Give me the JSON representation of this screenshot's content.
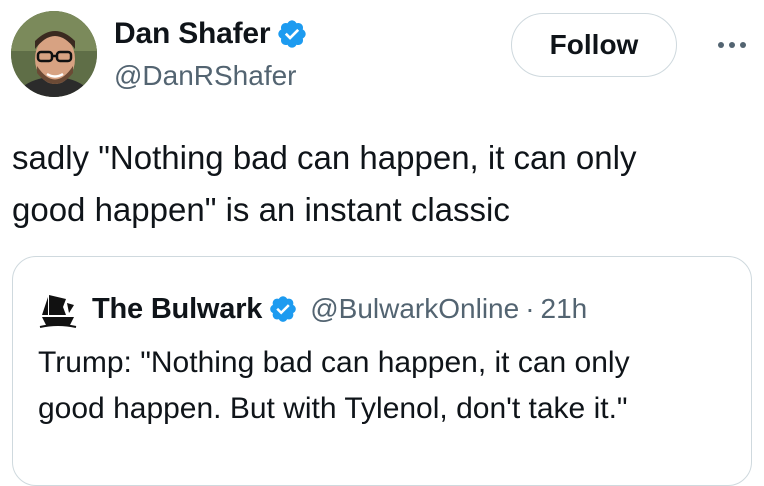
{
  "author": {
    "display_name": "Dan Shafer",
    "handle": "@DanRShafer",
    "verified_icon": "verified-badge-icon",
    "avatar_icon": "profile-photo"
  },
  "follow_label": "Follow",
  "more_icon": "more-options-icon",
  "tweet": {
    "lines": [
      "sadly \"Nothing bad can happen, it can only",
      "good happen\" is an instant classic"
    ]
  },
  "quoted": {
    "display_name": "The Bulwark",
    "handle": "@BulwarkOnline",
    "separator": "·",
    "time": "21h",
    "lines": [
      "Trump: \"Nothing bad can happen, it can only",
      "good happen. But with Tylenol, don't take it.\""
    ]
  },
  "colors": {
    "verified": "#1d9bf0",
    "secondary_text": "#536471",
    "primary_text": "#0f1419",
    "border": "#cfd9de"
  }
}
